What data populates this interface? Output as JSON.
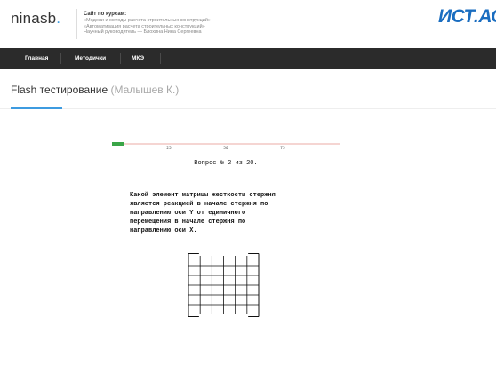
{
  "header": {
    "logo_main": "ninasb",
    "logo_dot": ".",
    "site_heading": "Сайт по курсам:",
    "course_lines": [
      "«Модели и методы расчета строительных конструкций»",
      "«Автоматизация расчета строительных конструкций»",
      "Научный руководитель — Блохина Нина Сергеевна"
    ],
    "brand": "ИСТ.АС"
  },
  "nav": {
    "items": [
      "Главная",
      "Методички",
      "МКЭ"
    ]
  },
  "page": {
    "title": "Flash тестирование",
    "subtitle": "(Малышев К.)"
  },
  "test": {
    "progress_fraction": 0.05,
    "progress_ticks": [
      "25",
      "50",
      "75"
    ],
    "question_counter": "Вопрос № 2 из 20.",
    "question_lines": [
      "Какой элемент матрицы жесткости стержня",
      "является реакцией в начале стержня по",
      "направлению оси Y от единичного",
      "перемещения в начале стержня по",
      "направлению оси X."
    ],
    "matrix_size": 6
  },
  "colors": {
    "accent": "#3d9be0",
    "brand": "#1a6dc0",
    "nav_bg": "#2b2b2b",
    "progress_fill": "#3aa547",
    "progress_track": "#f5d5d2"
  }
}
